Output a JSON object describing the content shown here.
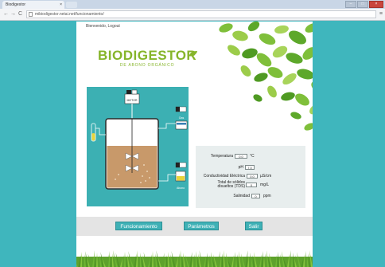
{
  "browser": {
    "tab_title": "Biodigestor",
    "tab_close": "×",
    "url": "mibiodigestor.netai.net/funcionamiento/",
    "back": "←",
    "forward": "→",
    "reload": "C",
    "menu": "≡",
    "win_min": "–",
    "win_max": "□",
    "win_close": "×"
  },
  "header": {
    "greeting": "Bienvenido, ",
    "logout": "Logout"
  },
  "logo": {
    "title": "BIODIGESTOR",
    "subtitle": "DE ABONO ORGÁNICO"
  },
  "diagram": {
    "motor_label": "MOTOR",
    "biogas_label": "Gas",
    "effluent_label": "Abono"
  },
  "parameters": {
    "temperature": {
      "label": "Temperatura",
      "value": "0.0",
      "unit": "°C"
    },
    "ph": {
      "label": "pH",
      "value": "7.0",
      "unit": ""
    },
    "conductivity": {
      "label": "Conductividad Eléctrica",
      "value": "0.0",
      "unit": "µS/cm"
    },
    "tds": {
      "label_line1": "Total de sólidos",
      "label_line2": "disueltos (TDS)",
      "value": "0",
      "unit": "mg/L"
    },
    "salinity": {
      "label": "Salinidad",
      "value": "0",
      "unit": "ppm"
    }
  },
  "buttons": {
    "funcionamiento": "Funcionamiento",
    "parametros": "Parámetros",
    "salir": "Salir"
  },
  "colors": {
    "background": "#3fb6bd",
    "accent_green": "#86b52a",
    "button": "#3fb1b6",
    "tank_fill": "#c8996a"
  }
}
